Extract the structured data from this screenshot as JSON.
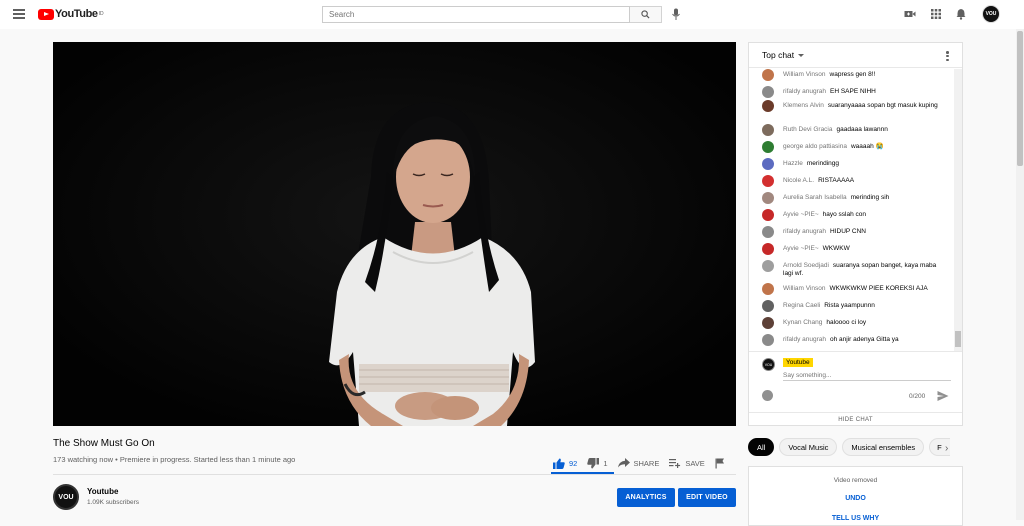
{
  "header": {
    "logo_text": "YouTube",
    "logo_reg": "ID",
    "search_placeholder": "Search",
    "icons": [
      "menu-icon",
      "search-icon",
      "mic-icon",
      "video-camera-icon",
      "apps-grid-icon",
      "bell-icon"
    ],
    "avatar_text": "VOU"
  },
  "video": {
    "title": "The Show Must Go On",
    "meta": "173 watching now • Premiere in progress. Started less than 1 minute ago",
    "likes": "92",
    "dislikes": "1",
    "share_label": "SHARE",
    "save_label": "SAVE"
  },
  "channel": {
    "name": "Youtube",
    "subscribers": "1.09K subscribers",
    "avatar_text": "VOU",
    "analytics_label": "ANALYTICS",
    "edit_label": "EDIT VIDEO"
  },
  "chat": {
    "header": "Top chat",
    "messages": [
      {
        "author": "William Vinson",
        "text": "wapress gen 8!!",
        "color": "#c0744a"
      },
      {
        "author": "rifaldy anugrah",
        "text": "EH SAPE NIHH",
        "color": "#8a8a8a"
      },
      {
        "author": "Klemens Alvin",
        "text": "suaranyaaaa sopan bgt masuk kuping",
        "color": "#6b3b2a"
      },
      {
        "author": "Ruth Devi Gracia",
        "text": "gaadaaa lawannn",
        "color": "#7d6b5d"
      },
      {
        "author": "george aldo pattiasina",
        "text": "waaaah 😭",
        "color": "#2e7d32"
      },
      {
        "author": "Hazzle",
        "text": "merindingg",
        "color": "#5c6bc0"
      },
      {
        "author": "Nicole A.L.",
        "text": "RISTAAAAA",
        "color": "#d32f2f"
      },
      {
        "author": "Aurelia Sarah Isabella",
        "text": "merinding sih",
        "color": "#a1887f"
      },
      {
        "author": "Ayvie ~PIE~",
        "text": "hayo sslah con",
        "color": "#c62828"
      },
      {
        "author": "rifaldy anugrah",
        "text": "HIDUP CNN",
        "color": "#8a8a8a"
      },
      {
        "author": "Ayvie ~PIE~",
        "text": "WKWKW",
        "color": "#c62828"
      },
      {
        "author": "Arnold Soedjadi",
        "text": "suaranya sopan banget, kaya maba lagi wf.",
        "color": "#9e9e9e"
      },
      {
        "author": "William Vinson",
        "text": "WKWKWKW PIEE KOREKSI AJA",
        "color": "#c0744a"
      },
      {
        "author": "Regina Caeli",
        "text": "Rista yaampunnn",
        "color": "#616161"
      },
      {
        "author": "Kynan Chang",
        "text": "haloooo ci loy",
        "color": "#5d4037"
      },
      {
        "author": "rifaldy anugrah",
        "text": "oh anjir adenya Gitta ya",
        "color": "#8a8a8a"
      }
    ],
    "compose_name": "Youtube",
    "compose_placeholder": "Say something...",
    "counter": "0/200",
    "hide_label": "HIDE CHAT"
  },
  "chips": [
    "All",
    "Vocal Music",
    "Musical ensembles",
    "F"
  ],
  "removed": {
    "text": "Video removed",
    "undo": "UNDO",
    "tell_us": "TELL US WHY"
  }
}
